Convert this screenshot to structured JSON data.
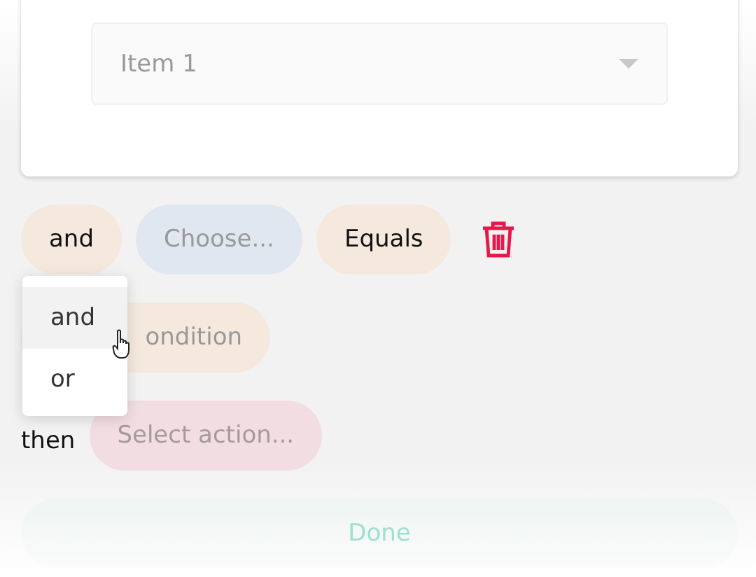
{
  "filter_card": {
    "select": {
      "value": "Item 1"
    }
  },
  "condition_row": {
    "connector": {
      "label": "and"
    },
    "field": {
      "label": "Choose..."
    },
    "operator": {
      "label": "Equals"
    }
  },
  "add_condition": {
    "label": "ondition"
  },
  "action_row": {
    "prefix": "then",
    "action": {
      "label": "Select action..."
    }
  },
  "connector_menu": {
    "items": [
      {
        "label": "and",
        "selected": true
      },
      {
        "label": "or",
        "selected": false
      }
    ]
  },
  "done_button": {
    "label": "Done"
  }
}
